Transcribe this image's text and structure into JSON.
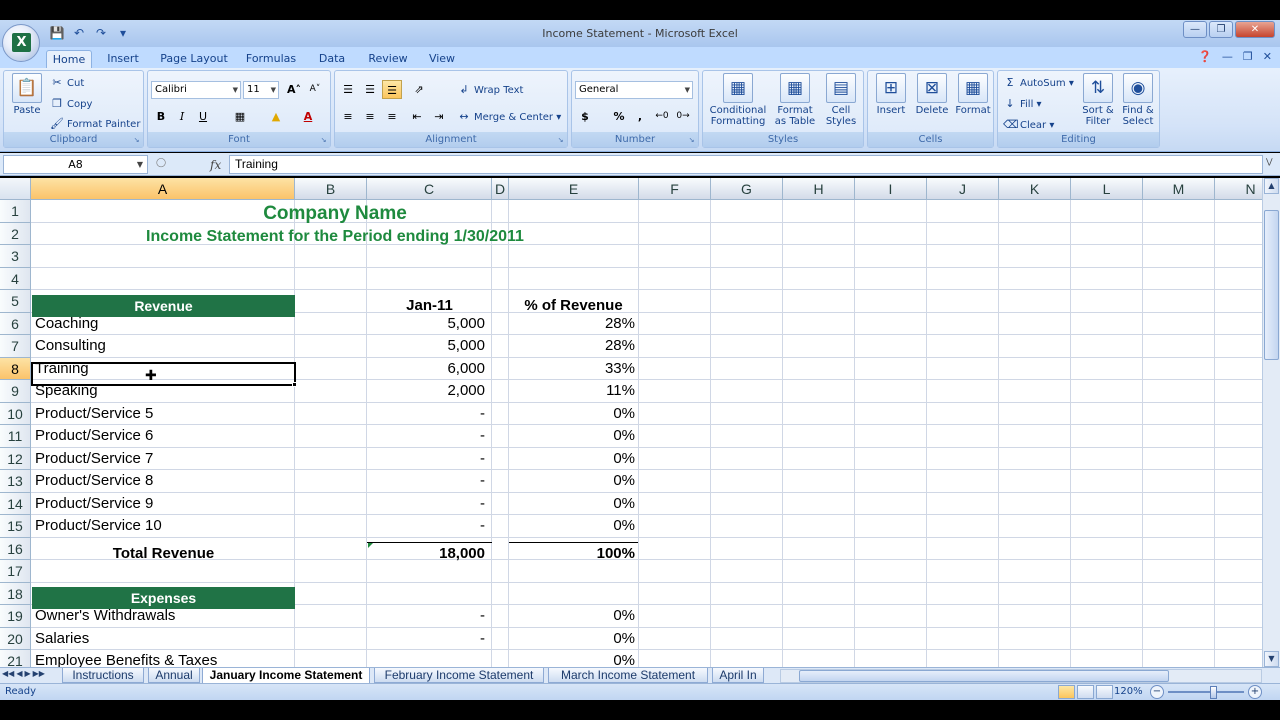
{
  "window": {
    "title": "Income Statement - Microsoft Excel",
    "app_icon": "excel-logo"
  },
  "qat": [
    "save-icon",
    "undo-icon",
    "redo-icon",
    "customize-icon"
  ],
  "tabs": [
    "Home",
    "Insert",
    "Page Layout",
    "Formulas",
    "Data",
    "Review",
    "View"
  ],
  "active_tab": "Home",
  "ribbon": {
    "clipboard": {
      "label": "Clipboard",
      "paste": "Paste",
      "cut": "Cut",
      "copy": "Copy",
      "format_painter": "Format Painter"
    },
    "font": {
      "label": "Font",
      "font_name": "Calibri",
      "font_size": "11",
      "bold": "B",
      "italic": "I",
      "underline": "U",
      "grow": "A",
      "shrink": "A",
      "font_color": "A"
    },
    "alignment": {
      "label": "Alignment",
      "wrap_text": "Wrap Text",
      "merge_center": "Merge & Center"
    },
    "number": {
      "label": "Number",
      "format": "General",
      "currency": "$",
      "percent": "%",
      "comma": ","
    },
    "styles": {
      "label": "Styles",
      "conditional_1": "Conditional",
      "conditional_2": "Formatting",
      "format_table_1": "Format",
      "format_table_2": "as Table",
      "cell_styles_1": "Cell",
      "cell_styles_2": "Styles"
    },
    "cells": {
      "label": "Cells",
      "insert": "Insert",
      "delete": "Delete",
      "format": "Format"
    },
    "editing": {
      "label": "Editing",
      "autosum": "AutoSum",
      "fill": "Fill",
      "clear": "Clear",
      "sort_1": "Sort &",
      "sort_2": "Filter",
      "find_1": "Find &",
      "find_2": "Select"
    }
  },
  "formula_bar": {
    "name_box": "A8",
    "fx": "fx",
    "content": "Training"
  },
  "columns": [
    "A",
    "B",
    "C",
    "D",
    "E",
    "F",
    "G",
    "H",
    "I",
    "J",
    "K",
    "L",
    "M",
    "N"
  ],
  "selected_column": "A",
  "rows": [
    "1",
    "2",
    "3",
    "4",
    "5",
    "6",
    "7",
    "8",
    "9",
    "10",
    "11",
    "12",
    "13",
    "14",
    "15",
    "16",
    "17",
    "18",
    "19",
    "20",
    "21"
  ],
  "selected_row": "8",
  "sheet": {
    "company_name": "Company Name",
    "statement_title": "Income Statement for the Period ending 1/30/2011",
    "revenue_header": "Revenue",
    "col_c_header": "Jan-11",
    "col_e_header": "% of Revenue",
    "revenue_lines": [
      {
        "name": "Coaching",
        "amount": "5,000",
        "pct": "28%"
      },
      {
        "name": "Consulting",
        "amount": "5,000",
        "pct": "28%"
      },
      {
        "name": "Training",
        "amount": "6,000",
        "pct": "33%"
      },
      {
        "name": "Speaking",
        "amount": "2,000",
        "pct": "11%"
      },
      {
        "name": "Product/Service 5",
        "amount": "-",
        "pct": "0%"
      },
      {
        "name": "Product/Service 6",
        "amount": "-",
        "pct": "0%"
      },
      {
        "name": "Product/Service 7",
        "amount": "-",
        "pct": "0%"
      },
      {
        "name": "Product/Service 8",
        "amount": "-",
        "pct": "0%"
      },
      {
        "name": "Product/Service 9",
        "amount": "-",
        "pct": "0%"
      },
      {
        "name": "Product/Service 10",
        "amount": "-",
        "pct": "0%"
      }
    ],
    "total_revenue": {
      "name": "Total Revenue",
      "amount": "18,000",
      "pct": "100%"
    },
    "expenses_header": "Expenses",
    "expense_lines": [
      {
        "name": "Owner's Withdrawals",
        "amount": "-",
        "pct": "0%"
      },
      {
        "name": "Salaries",
        "amount": "-",
        "pct": "0%"
      },
      {
        "name": "Employee Benefits & Taxes",
        "amount": "",
        "pct": "0%"
      }
    ]
  },
  "sheet_tabs": [
    "Instructions",
    "Annual",
    "January Income Statement",
    "February Income Statement",
    "March Income Statement",
    "April In"
  ],
  "active_sheet": "January Income Statement",
  "status": {
    "ready": "Ready",
    "zoom": "120%"
  },
  "colors": {
    "header_fill": "#207346",
    "title_green": "#1e8a3e",
    "selection": "#fbc36a"
  }
}
